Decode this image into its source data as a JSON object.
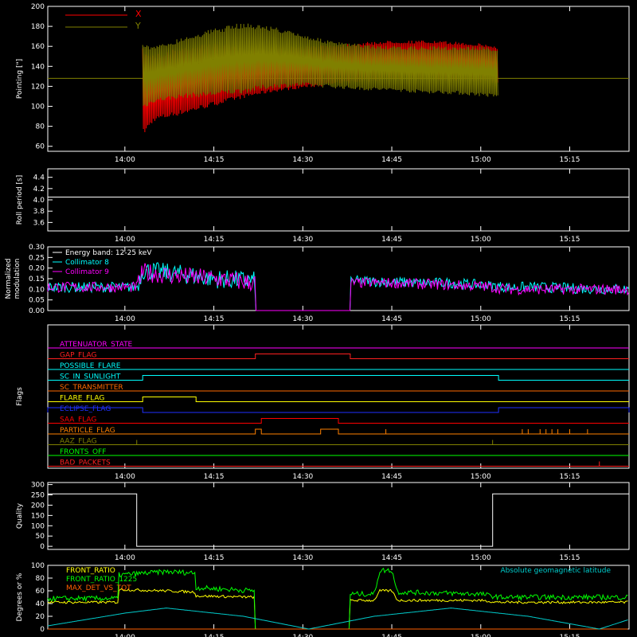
{
  "chart_data": [
    {
      "type": "line",
      "panel": "pointing",
      "ylabel": "Pointing [\"]",
      "xlabel": "",
      "ylim": [
        55,
        200
      ],
      "yticks": [
        60,
        80,
        100,
        120,
        140,
        160,
        180,
        200
      ],
      "x_ticks": [
        "14:00",
        "14:15",
        "14:30",
        "14:45",
        "15:00",
        "15:15"
      ],
      "x_time_range": [
        "13:47",
        "15:25"
      ],
      "legend_position": "top-left",
      "colors": {
        "X": "#ff0000",
        "Y": "#808000"
      },
      "series": [
        {
          "name": "X",
          "x": [
            "14:03",
            "14:05",
            "14:10",
            "14:15",
            "14:20",
            "14:25",
            "14:30",
            "14:35",
            "14:40",
            "14:45",
            "14:50",
            "14:55",
            "15:00",
            "15:03"
          ],
          "upper": [
            158,
            152,
            160,
            163,
            160,
            160,
            160,
            162,
            164,
            166,
            166,
            165,
            163,
            160
          ],
          "lower": [
            70,
            85,
            92,
            100,
            108,
            114,
            118,
            121,
            124,
            126,
            126,
            125,
            124,
            122
          ]
        },
        {
          "name": "Y",
          "x": [
            "14:03",
            "14:05",
            "14:10",
            "14:15",
            "14:20",
            "14:25",
            "14:30",
            "14:35",
            "14:40",
            "14:45",
            "14:50",
            "14:55",
            "15:00",
            "15:03"
          ],
          "upper": [
            163,
            160,
            170,
            178,
            184,
            180,
            172,
            165,
            162,
            160,
            160,
            160,
            160,
            158
          ],
          "lower": [
            97,
            104,
            108,
            110,
            113,
            118,
            120,
            118,
            116,
            115,
            113,
            112,
            110,
            108
          ],
          "baseline": 128
        }
      ]
    },
    {
      "type": "line",
      "panel": "roll",
      "ylabel": "Roll period [s]",
      "xlabel": "",
      "ylim": [
        3.45,
        4.55
      ],
      "yticks": [
        3.6,
        3.8,
        4.0,
        4.2,
        4.4
      ],
      "x_ticks": [
        "14:00",
        "14:15",
        "14:30",
        "14:45",
        "15:00",
        "15:15"
      ],
      "series": [
        {
          "name": "",
          "x": [
            "13:47",
            "15:25"
          ],
          "values": [
            4.05,
            4.05
          ]
        }
      ]
    },
    {
      "type": "line",
      "panel": "modulation",
      "ylabel": "Normalized modulation",
      "xlabel": "",
      "ylim": [
        0,
        0.3
      ],
      "yticks": [
        0.0,
        0.05,
        0.1,
        0.15,
        0.2,
        0.25,
        0.3
      ],
      "x_ticks": [
        "14:00",
        "14:15",
        "14:30",
        "14:45",
        "15:00",
        "15:15"
      ],
      "legend": [
        "Energy band: 12-25 keV",
        "Collimator 8",
        "Collimator 9"
      ],
      "colors": {
        "Collimator 8": "#00ffff",
        "Collimator 9": "#ff00ff"
      },
      "series": [
        {
          "name": "Collimator 8",
          "x": [
            "13:47",
            "14:02",
            "14:03",
            "14:10",
            "14:15",
            "14:22",
            "14:22",
            "14:38",
            "14:38",
            "14:45",
            "14:50",
            "14:55",
            "15:00",
            "15:05",
            "15:10",
            "15:15",
            "15:25"
          ],
          "values": [
            0.11,
            0.11,
            0.19,
            0.17,
            0.15,
            0.14,
            0,
            0,
            0.14,
            0.135,
            0.13,
            0.13,
            0.12,
            0.11,
            0.11,
            0.105,
            0.1
          ]
        },
        {
          "name": "Collimator 9",
          "x": [
            "13:47",
            "14:02",
            "14:03",
            "14:10",
            "14:15",
            "14:22",
            "14:22",
            "14:38",
            "14:38",
            "14:45",
            "14:50",
            "14:55",
            "15:00",
            "15:05",
            "15:10",
            "15:15",
            "15:25"
          ],
          "values": [
            0.11,
            0.11,
            0.18,
            0.16,
            0.15,
            0.13,
            0,
            0,
            0.13,
            0.13,
            0.125,
            0.12,
            0.115,
            0.1,
            0.1,
            0.1,
            0.1
          ]
        }
      ]
    },
    {
      "type": "line",
      "panel": "flags",
      "ylabel": "Flags",
      "xlabel": "",
      "x_ticks": [
        "14:00",
        "14:15",
        "14:30",
        "14:45",
        "15:00",
        "15:15"
      ],
      "series": [
        {
          "name": "ATTENUATOR_STATE",
          "color": "#ff00ff",
          "segments": []
        },
        {
          "name": "GAP_FLAG",
          "color": "#ff2020",
          "segments": [
            [
              "14:22",
              "14:38"
            ]
          ]
        },
        {
          "name": "POSSIBLE_FLARE",
          "color": "#00ffff",
          "segments": []
        },
        {
          "name": "SC_IN_SUNLIGHT",
          "color": "#00ffff",
          "segments": [
            [
              "14:03",
              "15:03"
            ]
          ]
        },
        {
          "name": "SC_TRANSMITTER",
          "color": "#ff6a00",
          "segments": []
        },
        {
          "name": "FLARE_FLAG",
          "color": "#ffff00",
          "segments": [
            [
              "14:03",
              "14:12"
            ]
          ]
        },
        {
          "name": "ECLIPSE_FLAG",
          "color": "#2030ff",
          "segments": [
            [
              "13:47",
              "14:03"
            ],
            [
              "15:03",
              "15:25"
            ]
          ]
        },
        {
          "name": "SAA_FLAG",
          "color": "#ff0000",
          "segments": [
            [
              "14:23",
              "14:36"
            ]
          ]
        },
        {
          "name": "PARTICLE_FLAG",
          "color": "#ff8000",
          "segments": [
            [
              "14:22",
              "14:23"
            ],
            [
              "14:33",
              "14:36"
            ]
          ],
          "spikes": [
            "14:44",
            "15:07",
            "15:08",
            "15:10",
            "15:11",
            "15:12",
            "15:13",
            "15:15",
            "15:18"
          ]
        },
        {
          "name": "AAZ_FLAG",
          "color": "#808000",
          "spikes": [
            "14:02",
            "15:02"
          ]
        },
        {
          "name": "FRONTS_OFF",
          "color": "#00ff00",
          "segments": []
        },
        {
          "name": "BAD_PACKETS",
          "color": "#ff2020",
          "spikes": [
            "15:20"
          ]
        }
      ]
    },
    {
      "type": "line",
      "panel": "quality",
      "ylabel": "Quality",
      "xlabel": "",
      "ylim": [
        -15,
        310
      ],
      "yticks": [
        0,
        50,
        100,
        150,
        200,
        250,
        300
      ],
      "x_ticks": [
        "14:00",
        "14:15",
        "14:30",
        "14:45",
        "15:00",
        "15:15"
      ],
      "series": [
        {
          "name": "",
          "x": [
            "13:47",
            "14:02",
            "14:02",
            "15:02",
            "15:02",
            "15:25"
          ],
          "values": [
            255,
            255,
            0,
            0,
            255,
            255
          ]
        }
      ]
    },
    {
      "type": "line",
      "panel": "ratios",
      "ylabel": "Degrees or %",
      "xlabel": "",
      "ylim": [
        0,
        100
      ],
      "yticks": [
        0,
        20,
        40,
        60,
        80,
        100
      ],
      "x_ticks": [
        "14:00",
        "14:15",
        "14:30",
        "14:45",
        "15:00",
        "15:15"
      ],
      "legend_right": "Absolute geomagnetic latitude",
      "series": [
        {
          "name": "FRONT_RATIO",
          "color": "#ffff00",
          "x": [
            "13:47",
            "13:59",
            "13:59",
            "14:07",
            "14:12",
            "14:12",
            "14:22",
            "14:22",
            "14:38",
            "14:38",
            "14:42",
            "14:43",
            "14:45",
            "14:46",
            "15:00",
            "15:03",
            "15:25"
          ],
          "values": [
            42,
            42,
            62,
            60,
            58,
            52,
            50,
            0,
            0,
            45,
            45,
            60,
            60,
            45,
            45,
            42,
            42
          ]
        },
        {
          "name": "FRONT_RATIO_1225",
          "color": "#00ff00",
          "x": [
            "13:47",
            "13:59",
            "13:59",
            "14:07",
            "14:12",
            "14:12",
            "14:22",
            "14:22",
            "14:38",
            "14:38",
            "14:42",
            "14:43",
            "14:45",
            "14:46",
            "15:00",
            "15:03",
            "15:25"
          ],
          "values": [
            48,
            48,
            85,
            90,
            88,
            65,
            60,
            0,
            0,
            55,
            55,
            92,
            92,
            58,
            55,
            50,
            50
          ]
        },
        {
          "name": "MAX_DET_VS_TOT",
          "color": "#ff6000",
          "x": [
            "13:47",
            "15:25"
          ],
          "values": [
            0,
            0
          ]
        },
        {
          "name": "Absolute geomagnetic latitude",
          "color": "#00cccc",
          "x": [
            "13:47",
            "14:00",
            "14:07",
            "14:20",
            "14:31",
            "14:42",
            "14:55",
            "15:08",
            "15:20",
            "15:25"
          ],
          "values": [
            5,
            25,
            33,
            20,
            0,
            20,
            33,
            20,
            0,
            15
          ]
        }
      ]
    }
  ]
}
